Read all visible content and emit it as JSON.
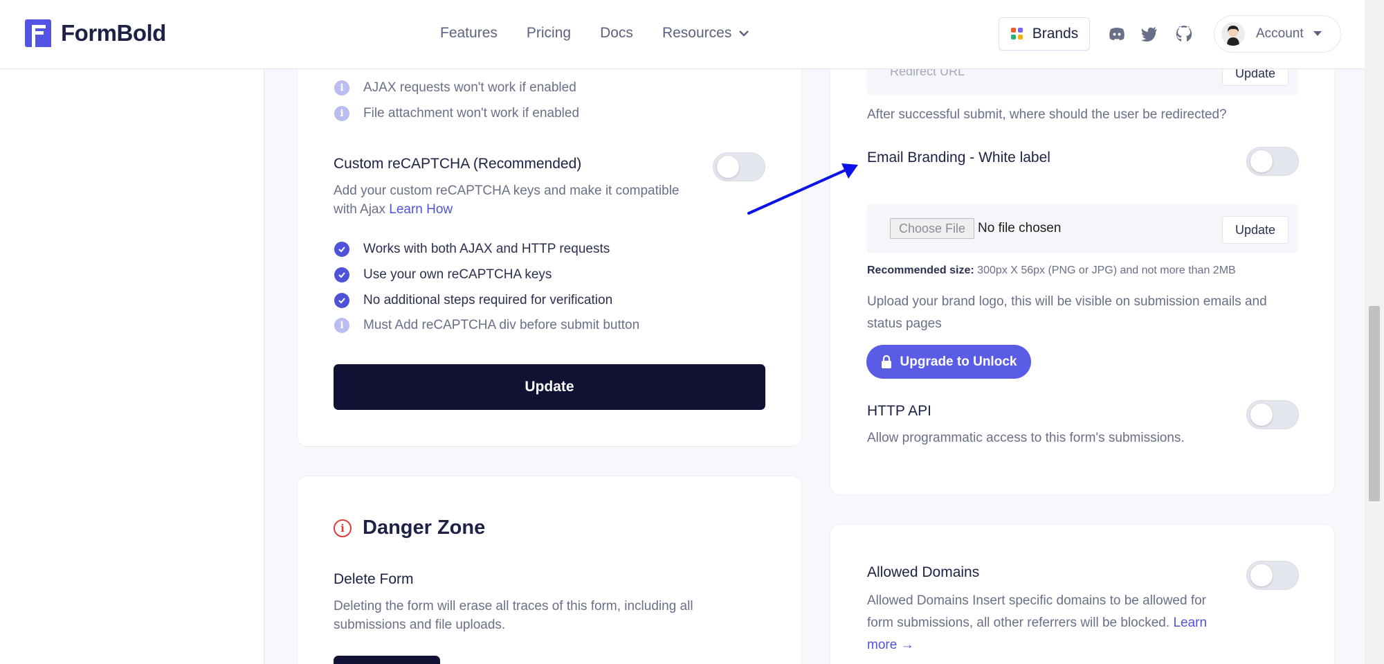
{
  "header": {
    "brand": "FormBold",
    "nav": [
      "Features",
      "Pricing",
      "Docs",
      "Resources"
    ],
    "brands_label": "Brands",
    "account_label": "Account"
  },
  "left_card": {
    "info_items": [
      "AJAX requests won't work if enabled",
      "File attachment won't work if enabled"
    ],
    "recaptcha_title": "Custom reCAPTCHA (Recommended)",
    "recaptcha_desc_line1": "Add your custom reCAPTCHA keys and make it compatible",
    "recaptcha_desc_line2": "with Ajax",
    "learn_how": "Learn How",
    "checks": [
      "Works with both AJAX and HTTP requests",
      "Use your own reCAPTCHA keys",
      "No additional steps required for verification"
    ],
    "note": "Must Add reCAPTCHA div before submit button",
    "update_button": "Update"
  },
  "danger": {
    "title": "Danger Zone",
    "delete_title": "Delete Form",
    "delete_desc_line1": "Deleting the form will erase all traces of this form, including all",
    "delete_desc_line2": "submissions and file uploads."
  },
  "right_card": {
    "redirect_placeholder": "Redirect URL",
    "redirect_update": "Update",
    "redirect_help": "After successful submit, where should the user be redirected?",
    "branding_title": "Email Branding - White label",
    "choose_file": "Choose File",
    "no_file": "No file chosen",
    "file_update": "Update",
    "rec_size_label": "Recommended size:",
    "rec_size_value": "300px X 56px (PNG or JPG) and not more than 2MB",
    "upload_desc_line1": "Upload your brand logo, this will be visible on submission emails and",
    "upload_desc_line2": "status pages",
    "upgrade_button": "Upgrade to Unlock",
    "http_api_title": "HTTP API",
    "http_api_desc": "Allow programmatic access to this form's submissions."
  },
  "domains_card": {
    "title": "Allowed Domains",
    "desc_line1": "Allowed Domains Insert specific domains to be allowed for",
    "desc_line2": "form submissions, all other referrers will be blocked.",
    "learn": "Learn",
    "more": "more →"
  },
  "colors": {
    "accent": "#4f52d8",
    "dark_button": "#111133",
    "arrow": "#0a12e8",
    "danger": "#e03b3b"
  }
}
